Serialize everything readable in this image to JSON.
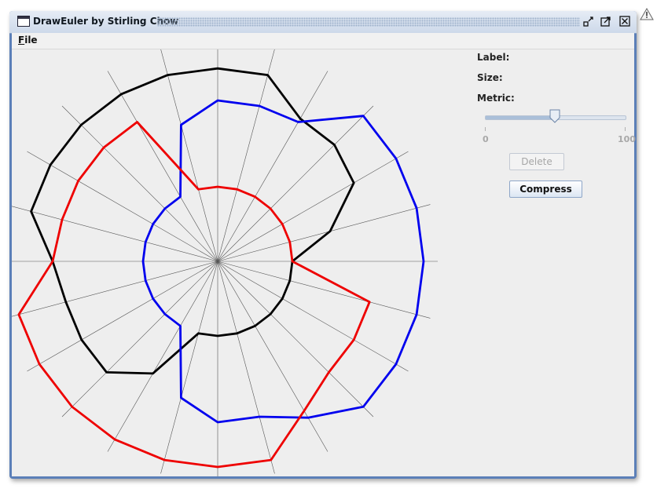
{
  "window": {
    "title": "DrawEuler by Stirling Chow",
    "buttons": {
      "minimize": "▪",
      "maximize": "◩",
      "close": "☒"
    }
  },
  "menu": {
    "file_label": "File",
    "file_mnemonic": "F",
    "file_rest": "ile"
  },
  "panel": {
    "label_text": "Label:",
    "size_text": "Size:",
    "metric_text": "Metric:",
    "slider": {
      "min_label": "0",
      "max_label": "100",
      "value": 50
    },
    "delete_label": "Delete",
    "compress_label": "Compress",
    "delete_enabled": false
  },
  "diagram": {
    "spoke_count": 24,
    "curves": [
      {
        "color": "#000000",
        "radius_fraction": 0.37
      },
      {
        "color": "#0000ee",
        "radius_fraction": 0.37
      },
      {
        "color": "#ee0000",
        "radius_fraction": 0.37
      }
    ]
  },
  "colors": {
    "window_frame": "#5b7fb8",
    "panel_bg": "#eeeeee"
  }
}
